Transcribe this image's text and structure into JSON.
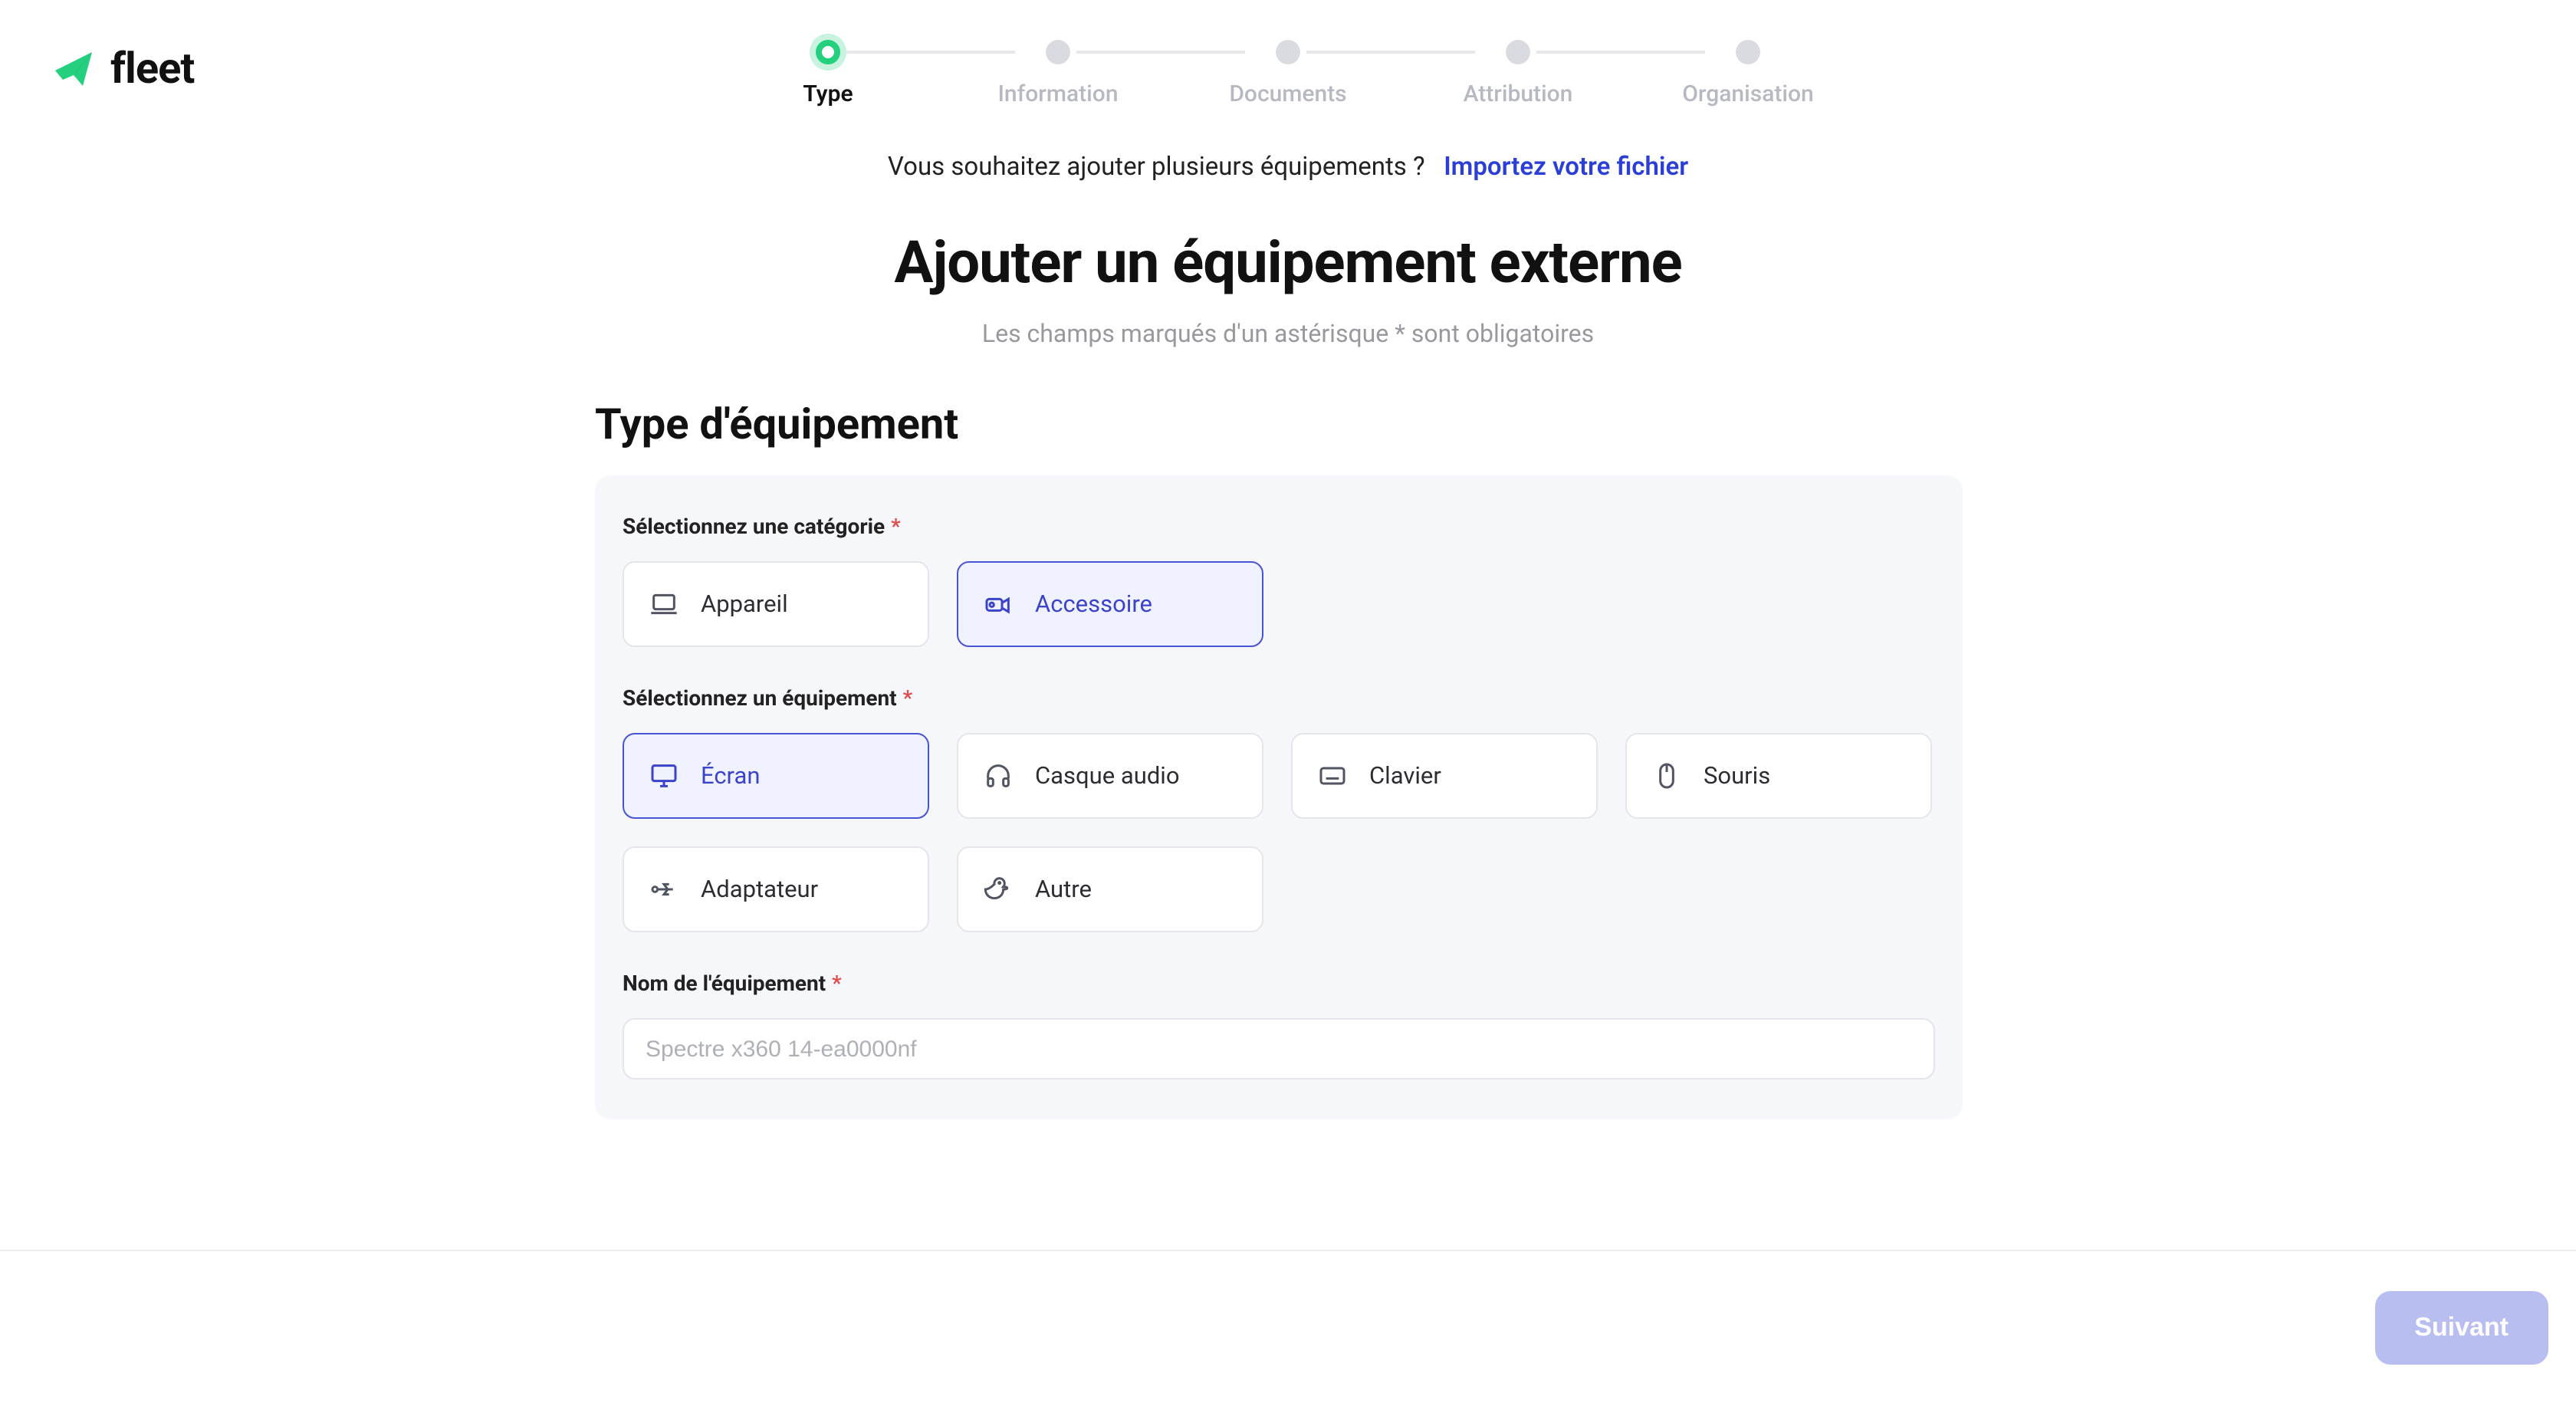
{
  "brand": {
    "name": "fleet"
  },
  "stepper": {
    "steps": [
      {
        "label": "Type",
        "active": true
      },
      {
        "label": "Information",
        "active": false
      },
      {
        "label": "Documents",
        "active": false
      },
      {
        "label": "Attribution",
        "active": false
      },
      {
        "label": "Organisation",
        "active": false
      }
    ]
  },
  "import": {
    "prompt": "Vous souhaitez ajouter plusieurs équipements ?",
    "link": "Importez votre fichier"
  },
  "headings": {
    "page_title": "Ajouter un équipement externe",
    "required_note": "Les champs marqués d'un astérisque * sont obligatoires",
    "section_title": "Type d'équipement"
  },
  "form": {
    "category": {
      "label": "Sélectionnez une catégorie",
      "options": [
        {
          "id": "appareil",
          "label": "Appareil",
          "icon": "laptop-icon",
          "selected": false
        },
        {
          "id": "accessoire",
          "label": "Accessoire",
          "icon": "camcorder-icon",
          "selected": true
        }
      ]
    },
    "equipment": {
      "label": "Sélectionnez un équipement",
      "options": [
        {
          "id": "ecran",
          "label": "Écran",
          "icon": "monitor-icon",
          "selected": true
        },
        {
          "id": "casque",
          "label": "Casque audio",
          "icon": "headphones-icon",
          "selected": false
        },
        {
          "id": "clavier",
          "label": "Clavier",
          "icon": "keyboard-icon",
          "selected": false
        },
        {
          "id": "souris",
          "label": "Souris",
          "icon": "mouse-icon",
          "selected": false
        },
        {
          "id": "adaptateur",
          "label": "Adaptateur",
          "icon": "usb-icon",
          "selected": false
        },
        {
          "id": "autre",
          "label": "Autre",
          "icon": "duck-icon",
          "selected": false
        }
      ]
    },
    "name": {
      "label": "Nom de l'équipement",
      "placeholder": "Spectre x360 14-ea0000nf",
      "value": ""
    }
  },
  "footer": {
    "next_label": "Suivant",
    "next_enabled": false
  },
  "colors": {
    "brand_green": "#24d07d",
    "accent_indigo": "#4853d6",
    "danger": "#e24a4a"
  }
}
